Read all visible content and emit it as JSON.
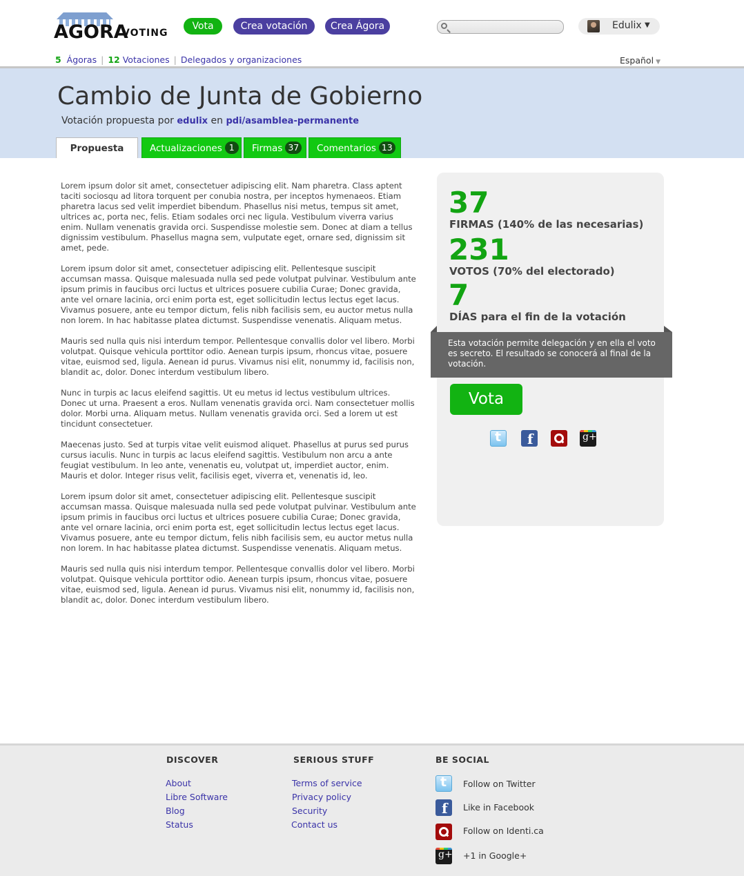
{
  "logo": {
    "word": "AGORA",
    "sub": "VOTING"
  },
  "header": {
    "buttons": [
      "Vota",
      "Crea votación",
      "Crea Ágora"
    ],
    "search_placeholder": "",
    "user": {
      "name": "Edulix",
      "caret": "▼"
    }
  },
  "subnav": {
    "agoras_count": "5",
    "agoras_label": "Ágoras",
    "votes_count": "12",
    "votes_label": "Votaciones",
    "delegates_label": "Delegados y organizaciones",
    "separator": "|"
  },
  "language": {
    "label": "Español",
    "caret": "▼"
  },
  "voting": {
    "title": "Cambio de Junta de Gobierno",
    "proposed_prefix": "Votación propuesta por",
    "author": "edulix",
    "in_label": "en",
    "agora": "pdi/asamblea-permanente"
  },
  "tabs": [
    {
      "label": "Propuesta"
    },
    {
      "label": "Actualizaciones",
      "count": "1"
    },
    {
      "label": "Firmas",
      "count": "37"
    },
    {
      "label": "Comentarios",
      "count": "13"
    }
  ],
  "body": {
    "paragraphs": [
      "Lorem ipsum dolor sit amet, consectetuer adipiscing elit. Nam pharetra. Class aptent taciti sociosqu ad litora torquent per conubia nostra, per inceptos hymenaeos. Etiam pharetra lacus sed velit imperdiet bibendum. Phasellus nisi metus, tempus sit amet, ultrices ac, porta nec, felis. Etiam sodales orci nec ligula. Vestibulum viverra varius enim. Nullam venenatis gravida orci. Suspendisse molestie sem. Donec at diam a tellus dignissim vestibulum. Phasellus magna sem, vulputate eget, ornare sed, dignissim sit amet, pede.",
      "Lorem ipsum dolor sit amet, consectetuer adipiscing elit. Pellentesque suscipit accumsan massa. Quisque malesuada nulla sed pede volutpat pulvinar. Vestibulum ante ipsum primis in faucibus orci luctus et ultrices posuere cubilia Curae; Donec gravida, ante vel ornare lacinia, orci enim porta est, eget sollicitudin lectus lectus eget lacus. Vivamus posuere, ante eu tempor dictum, felis nibh facilisis sem, eu auctor metus nulla non lorem. In hac habitasse platea dictumst. Suspendisse venenatis. Aliquam metus.",
      "Mauris sed nulla quis nisi interdum tempor. Pellentesque convallis dolor vel libero. Morbi volutpat. Quisque vehicula porttitor odio. Aenean turpis ipsum, rhoncus vitae, posuere vitae, euismod sed, ligula. Aenean id purus. Vivamus nisi elit, nonummy id, facilisis non, blandit ac, dolor. Donec interdum vestibulum libero.",
      "Nunc in turpis ac lacus eleifend sagittis. Ut eu metus id lectus vestibulum ultrices. Donec ut urna. Praesent a eros. Nullam venenatis gravida orci. Nam consectetuer mollis dolor. Morbi urna. Aliquam metus. Nullam venenatis gravida orci. Sed a lorem ut est tincidunt consectetuer.",
      "Maecenas justo. Sed at turpis vitae velit euismod aliquet. Phasellus at purus sed purus cursus iaculis. Nunc in turpis ac lacus eleifend sagittis. Vestibulum non arcu a ante feugiat vestibulum. In leo ante, venenatis eu, volutpat ut, imperdiet auctor, enim. Mauris et dolor. Integer risus velit, facilisis eget, viverra et, venenatis id, leo.",
      "Lorem ipsum dolor sit amet, consectetuer adipiscing elit. Pellentesque suscipit accumsan massa. Quisque malesuada nulla sed pede volutpat pulvinar. Vestibulum ante ipsum primis in faucibus orci luctus et ultrices posuere cubilia Curae; Donec gravida, ante vel ornare lacinia, orci enim porta est, eget sollicitudin lectus lectus eget lacus. Vivamus posuere, ante eu tempor dictum, felis nibh facilisis sem, eu auctor metus nulla non lorem. In hac habitasse platea dictumst. Suspendisse venenatis. Aliquam metus.",
      "Mauris sed nulla quis nisi interdum tempor. Pellentesque convallis dolor vel libero. Morbi volutpat. Quisque vehicula porttitor odio. Aenean turpis ipsum, rhoncus vitae, posuere vitae, euismod sed, ligula. Aenean id purus. Vivamus nisi elit, nonummy id, facilisis non, blandit ac, dolor. Donec interdum vestibulum libero."
    ]
  },
  "stats": {
    "signatures": {
      "value": "37",
      "label": "FIRMAS (140% de las necesarias)"
    },
    "votes": {
      "value": "231",
      "label": "VOTOS (70% del electorado)"
    },
    "days": {
      "value": "7",
      "label": "DÍAS para el fin de la votación"
    },
    "notice": "Esta votación permite delegación y en ella el voto es secreto. El resultado se conocerá al final de la votación.",
    "vote_button": "Vota",
    "share_icons": [
      "twitter-icon",
      "facebook-icon",
      "identica-icon",
      "google-plus-icon"
    ]
  },
  "footer": {
    "discover": {
      "heading": "DISCOVER",
      "links": [
        "About",
        "Libre Software",
        "Blog",
        "Status"
      ]
    },
    "serious": {
      "heading": "SERIOUS STUFF",
      "links": [
        "Terms of service",
        "Privacy policy",
        "Security",
        "Contact us"
      ]
    },
    "social": {
      "heading": "BE SOCIAL",
      "links": [
        {
          "icon": "twitter-icon",
          "label": "Follow on Twitter"
        },
        {
          "icon": "facebook-icon",
          "label": "Like in Facebook"
        },
        {
          "icon": "identica-icon",
          "label": "Follow on Identi.ca"
        },
        {
          "icon": "google-plus-icon",
          "label": "+1 in Google+"
        }
      ]
    }
  },
  "colors": {
    "brand_green": "#12b312",
    "brand_purple": "#4b3fa0",
    "link": "#3a33a8",
    "banner": "#d3e0f2",
    "tab_green": "#12c912"
  }
}
